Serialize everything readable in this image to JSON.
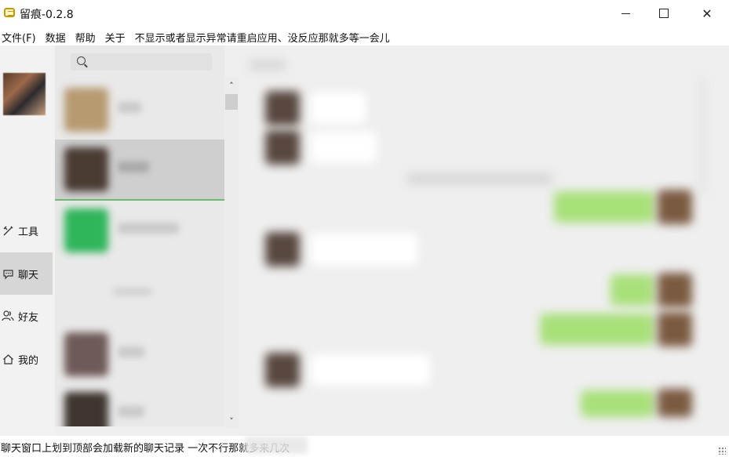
{
  "window": {
    "title": "留痕-0.2.8",
    "minimize_icon": "minimize-icon",
    "maximize_icon": "maximize-icon",
    "close_icon": "close-icon"
  },
  "menu": {
    "file": "文件(F)",
    "data": "数据",
    "help": "帮助",
    "about": "关于",
    "notice": "不显示或者显示异常请重启应用、没反应那就多等一会儿"
  },
  "nav": {
    "tools": "工具",
    "chat": "聊天",
    "friends": "好友",
    "me": "我的",
    "tools_icon": "tools-icon",
    "chat_icon": "chat-bubble-icon",
    "friends_icon": "friends-icon",
    "me_icon": "home-icon"
  },
  "search": {
    "icon": "search-icon"
  },
  "scrollbar": {
    "up": "˄",
    "down": "˅"
  },
  "status": {
    "text": "聊天窗口上划到顶部会加载新的聊天记录 一次不行那就多来几次"
  },
  "colors": {
    "accent_green": "#3aa53a",
    "bubble_green": "#a8e07a",
    "selected_item": "#cfcfcf"
  }
}
